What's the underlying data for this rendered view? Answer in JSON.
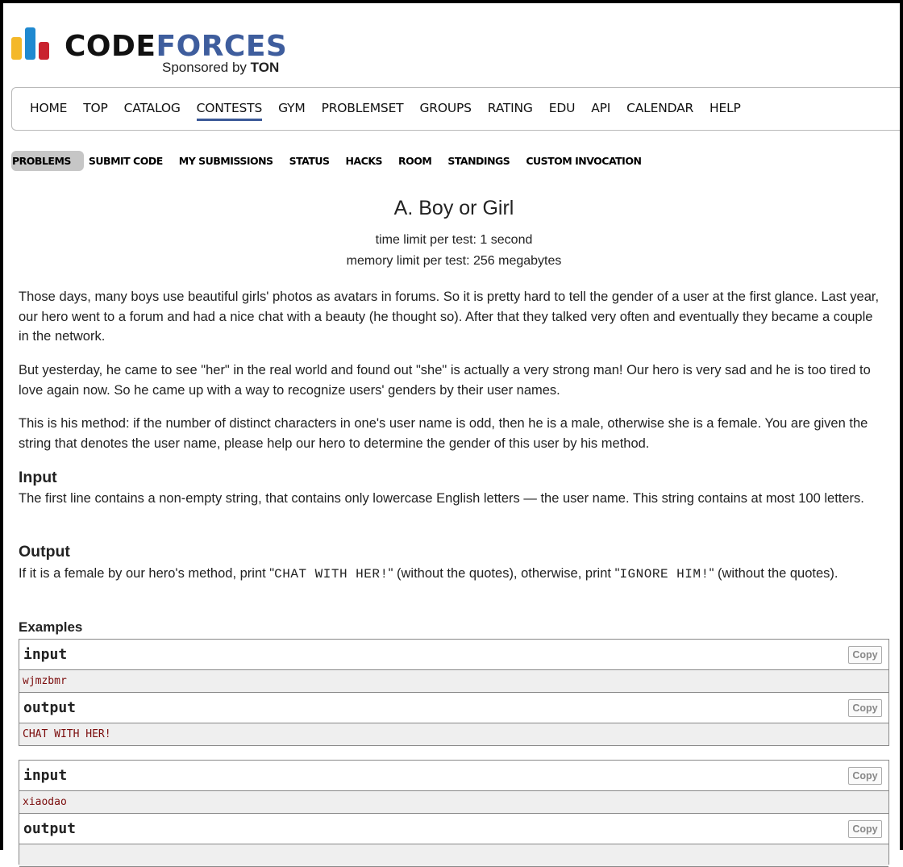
{
  "brand": {
    "word_code": "CODE",
    "word_forces": "FORCES",
    "sponsored_prefix": "Sponsored by",
    "sponsor": "TON",
    "colors": {
      "bar_yellow": "#f4b829",
      "bar_blue": "#1f89d0",
      "bar_red": "#c9232f",
      "forces": "#3e5d9d"
    }
  },
  "main_menu": {
    "active": "CONTESTS",
    "items": [
      "HOME",
      "TOP",
      "CATALOG",
      "CONTESTS",
      "GYM",
      "PROBLEMSET",
      "GROUPS",
      "RATING",
      "EDU",
      "API",
      "CALENDAR",
      "HELP"
    ]
  },
  "sub_menu": {
    "active": "PROBLEMS",
    "items": [
      "PROBLEMS",
      "SUBMIT CODE",
      "MY SUBMISSIONS",
      "STATUS",
      "HACKS",
      "ROOM",
      "STANDINGS",
      "CUSTOM INVOCATION"
    ]
  },
  "problem": {
    "title": "A. Boy or Girl",
    "time_limit": "time limit per test: 1 second",
    "memory_limit": "memory limit per test: 256 megabytes",
    "statement": [
      "Those days, many boys use beautiful girls' photos as avatars in forums. So it is pretty hard to tell the gender of a user at the first glance. Last year, our hero went to a forum and had a nice chat with a beauty (he thought so). After that they talked very often and eventually they became a couple in the network.",
      "But yesterday, he came to see \"her\" in the real world and found out \"she\" is actually a very strong man! Our hero is very sad and he is too tired to love again now. So he came up with a way to recognize users' genders by their user names.",
      "This is his method: if the number of distinct characters in one's user name is odd, then he is a male, otherwise she is a female. You are given the string that denotes the user name, please help our hero to determine the gender of this user by his method."
    ],
    "input_heading": "Input",
    "input_text": "The first line contains a non-empty string, that contains only lowercase English letters — the user name. This string contains at most 100 letters.",
    "output_heading": "Output",
    "output_text": {
      "part1": "If it is a female by our hero's method, print \"",
      "code1": "CHAT WITH HER!",
      "part2": "\" (without the quotes), otherwise, print \"",
      "code2": "IGNORE HIM!",
      "part3": "\" (without the quotes)."
    },
    "examples_heading": "Examples"
  },
  "samples": [
    {
      "input_label": "input",
      "input": "wjmzbmr",
      "output_label": "output",
      "output": "CHAT WITH HER!",
      "copy_label": "Copy"
    },
    {
      "input_label": "input",
      "input": "xiaodao",
      "output_label": "output",
      "output": "",
      "copy_label": "Copy"
    }
  ]
}
